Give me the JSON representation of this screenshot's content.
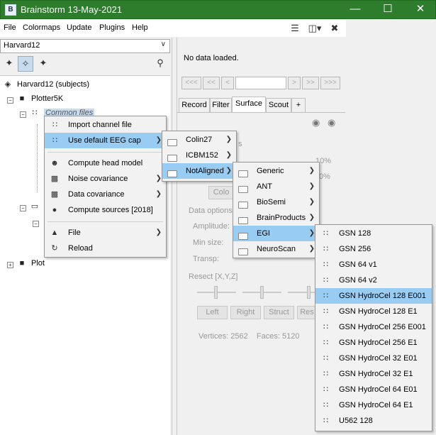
{
  "window": {
    "title": "Brainstorm 13-May-2021",
    "app_icon_text": "B",
    "minimize": "—",
    "maximize": "☐",
    "close": "✕"
  },
  "menubar": {
    "items": [
      "File",
      "Colormaps",
      "Update",
      "Plugins",
      "Help"
    ]
  },
  "left": {
    "protocol": "Harvard12",
    "tree": {
      "root": "Harvard12 (subjects)",
      "subject1": "Plotter5K",
      "common_files": "Common files",
      "subject2": "Plot"
    }
  },
  "right": {
    "status": "No data loaded.",
    "nav": [
      "<<<",
      "<<",
      "<",
      ">",
      ">>",
      ">>>"
    ],
    "tabs": [
      "Record",
      "Filter",
      "Surface",
      "Scout",
      "+"
    ],
    "partial": {
      "opacity_suffix": "s",
      "pct1": "10%",
      "pct2": "0%",
      "colormap_btn": "Colo"
    },
    "data_options": {
      "header": "Data options",
      "amplitude": "Amplitude:",
      "min_size": "Min size:",
      "transp": "Transp:"
    },
    "resect": {
      "header": "Resect [X,Y,Z]",
      "buttons": [
        "Left",
        "Right",
        "Struct",
        "Res"
      ]
    },
    "stats": "Vertices: 2562    Faces: 5120"
  },
  "context_menu": {
    "items": [
      {
        "label": "Import channel file",
        "icon": "dots-icon"
      },
      {
        "label": "Use default EEG cap",
        "icon": "dots-icon",
        "sub": true
      },
      {
        "label": "Compute head model",
        "icon": "head-icon"
      },
      {
        "label": "Noise covariance",
        "icon": "matrix-icon",
        "sub": true
      },
      {
        "label": "Data covariance",
        "icon": "matrix-icon",
        "sub": true
      },
      {
        "label": "Compute sources [2018]",
        "icon": "brain-icon"
      },
      {
        "label": "File",
        "icon": "file-icon",
        "sub": true
      },
      {
        "label": "Reload",
        "icon": "reload-icon"
      }
    ]
  },
  "templates_menu": {
    "items": [
      "Colin27",
      "ICBM152",
      "NotAligned"
    ]
  },
  "manufacturer_menu": {
    "items": [
      "Generic",
      "ANT",
      "BioSemi",
      "BrainProducts",
      "EGI",
      "NeuroScan"
    ]
  },
  "caps_menu": {
    "items": [
      "GSN 128",
      "GSN 256",
      "GSN 64 v1",
      "GSN 64 v2",
      "GSN HydroCel 128 E001",
      "GSN HydroCel 128 E1",
      "GSN HydroCel 256 E001",
      "GSN HydroCel 256 E1",
      "GSN HydroCel 32 E01",
      "GSN HydroCel 32 E1",
      "GSN HydroCel 64 E01",
      "GSN HydroCel 64 E1",
      "U562 128"
    ],
    "highlighted": "GSN HydroCel 128 E001"
  },
  "colors": {
    "titlebar": "#2d7d2d",
    "highlight": "#99ccf2"
  }
}
